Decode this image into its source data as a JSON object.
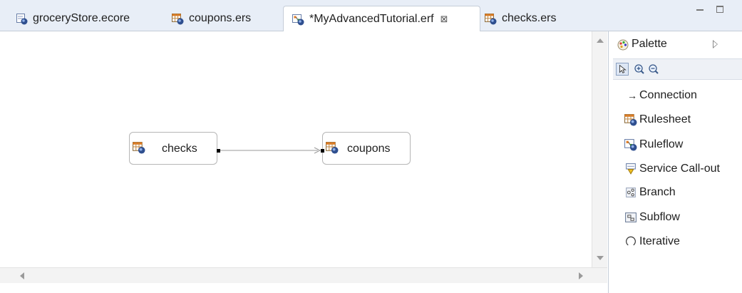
{
  "tabs": [
    {
      "label": "groceryStore.ecore",
      "icon": "ecore-icon",
      "active": false
    },
    {
      "label": "coupons.ers",
      "icon": "rulesheet-icon",
      "active": false
    },
    {
      "label": "*MyAdvancedTutorial.erf",
      "icon": "ruleflow-icon",
      "active": true
    },
    {
      "label": "checks.ers",
      "icon": "rulesheet-icon",
      "active": false
    }
  ],
  "active_tab_close": "⊠",
  "diagram": {
    "nodes": [
      {
        "label": "checks",
        "icon": "rulesheet-icon"
      },
      {
        "label": "coupons",
        "icon": "rulesheet-icon"
      }
    ]
  },
  "palette": {
    "title": "Palette",
    "tools": [
      "select-tool",
      "zoom-in-tool",
      "zoom-out-tool"
    ],
    "items": [
      {
        "label": "Connection",
        "icon": "arrow-right-icon",
        "glyph": "→"
      },
      {
        "label": "Rulesheet",
        "icon": "rulesheet-icon"
      },
      {
        "label": "Ruleflow",
        "icon": "ruleflow-icon"
      },
      {
        "label": "Service Call-out",
        "icon": "service-callout-icon"
      },
      {
        "label": "Branch",
        "icon": "branch-icon"
      },
      {
        "label": "Subflow",
        "icon": "subflow-icon"
      },
      {
        "label": "Iterative",
        "icon": "iterative-icon"
      }
    ]
  },
  "colors": {
    "tabbar_bg": "#e8eef7",
    "node_border": "#b6b6b6",
    "connection": "#9a9a9a",
    "rulesheet_orange": "#e07a1f",
    "rulesheet_blue": "#2f4f8f"
  }
}
